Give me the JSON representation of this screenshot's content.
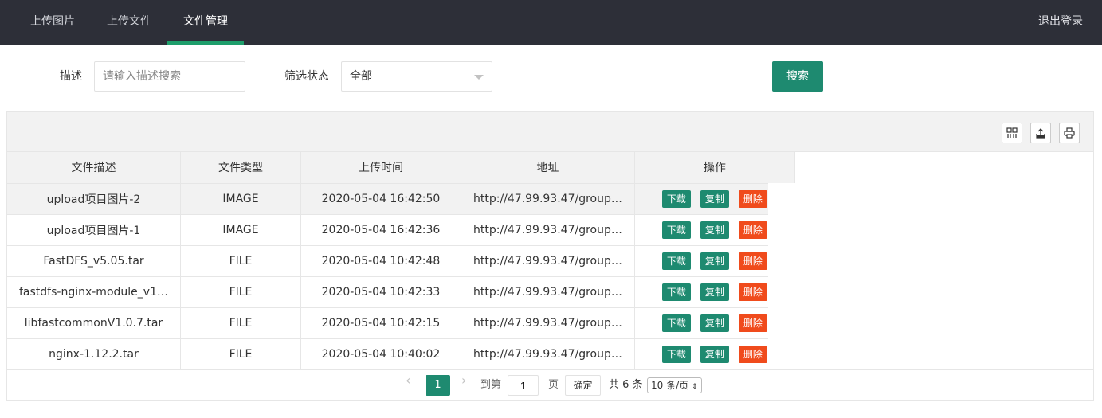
{
  "nav": {
    "tabs": [
      "上传图片",
      "上传文件",
      "文件管理"
    ],
    "active_index": 2,
    "logout": "退出登录"
  },
  "search": {
    "desc_label": "描述",
    "desc_placeholder": "请输入描述搜索",
    "status_label": "筛选状态",
    "status_value": "全部",
    "search_button": "搜索"
  },
  "table": {
    "columns": [
      "文件描述",
      "文件类型",
      "上传时间",
      "地址",
      "操作"
    ],
    "rows": [
      {
        "desc": "upload项目图片-2",
        "type": "IMAGE",
        "time": "2020-05-04 16:42:50",
        "addr": "http://47.99.93.47/group…"
      },
      {
        "desc": "upload项目图片-1",
        "type": "IMAGE",
        "time": "2020-05-04 16:42:36",
        "addr": "http://47.99.93.47/group…"
      },
      {
        "desc": "FastDFS_v5.05.tar",
        "type": "FILE",
        "time": "2020-05-04 10:42:48",
        "addr": "http://47.99.93.47/group…"
      },
      {
        "desc": "fastdfs-nginx-module_v1…",
        "type": "FILE",
        "time": "2020-05-04 10:42:33",
        "addr": "http://47.99.93.47/group…"
      },
      {
        "desc": "libfastcommonV1.0.7.tar",
        "type": "FILE",
        "time": "2020-05-04 10:42:15",
        "addr": "http://47.99.93.47/group…"
      },
      {
        "desc": "nginx-1.12.2.tar",
        "type": "FILE",
        "time": "2020-05-04 10:40:02",
        "addr": "http://47.99.93.47/group…"
      }
    ],
    "actions": {
      "download": "下载",
      "copy": "复制",
      "delete": "删除"
    }
  },
  "pagination": {
    "current": "1",
    "goto_label": "到第",
    "goto_value": "1",
    "page_unit": "页",
    "confirm": "确定",
    "total": "共 6 条",
    "page_size": "10 条/页"
  },
  "icons": {
    "toolbar": [
      "columns-icon",
      "export-icon",
      "print-icon"
    ]
  },
  "colors": {
    "nav_bg": "#2d2f38",
    "nav_active": "#1e9e6b",
    "primary": "#1e8a70",
    "danger": "#f04b1c"
  }
}
